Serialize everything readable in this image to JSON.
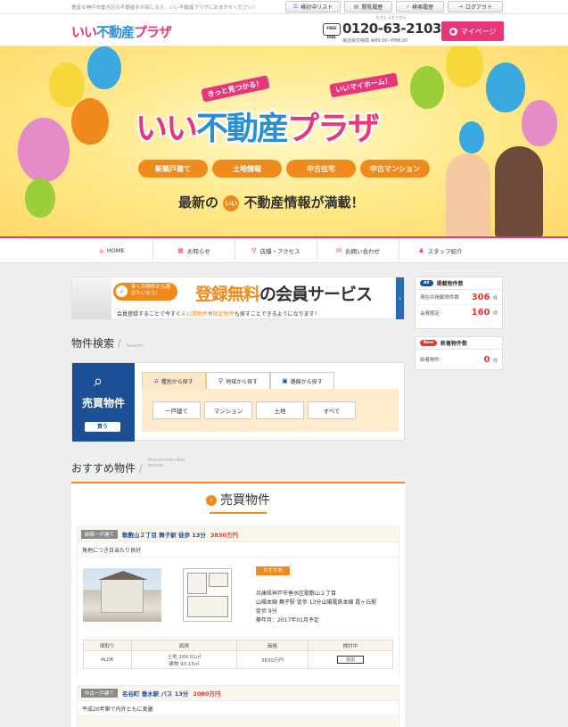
{
  "topbar": {
    "tagline": "豊富な神戸市垂水区の不動産をお探しなら、いい不動産プラザにおまかせください！",
    "buttons": [
      {
        "icon": "list-icon",
        "label": "検討中リスト"
      },
      {
        "icon": "history-icon",
        "label": "閲覧履歴"
      },
      {
        "icon": "search-icon",
        "label": "検索履歴"
      },
      {
        "icon": "logout-icon",
        "label": "ログアウト"
      }
    ]
  },
  "header": {
    "logo": "いい不動産プラザ",
    "phone_badge": "FREE DIAL",
    "phone": "0120-63-2103",
    "phone_ruby": "むさし  ふどうさん",
    "hours": "電話受付時間 AM9:00~PM8:00",
    "mypage": "マイページ"
  },
  "hero": {
    "kicker_left": "きっと見つかる！",
    "kicker_right": "いいマイホーム！",
    "title_a": "いい",
    "title_b": "不動産",
    "title_c": "プラザ",
    "tags": [
      "新築戸建て",
      "土地情報",
      "中古住宅",
      "中古マンション"
    ],
    "banner_pre": "最新の",
    "banner_icon": "いい",
    "banner_post": "不動産情報が満載！"
  },
  "nav": [
    {
      "icon": "home-icon",
      "label": "HOME"
    },
    {
      "icon": "news-icon",
      "label": "お知らせ"
    },
    {
      "icon": "pin-icon",
      "label": "店舗・アクセス"
    },
    {
      "icon": "mail-icon",
      "label": "お問い合わせ"
    },
    {
      "icon": "person-icon",
      "label": "スタッフ紹介"
    }
  ],
  "register": {
    "bubble": "多くの物件から選びたいなら！",
    "big_a": "登録無料",
    "big_b": "の会員サービス",
    "sub_a": "会員登録することで今すぐ",
    "sub_b": "未公開物件",
    "sub_c": "や",
    "sub_d": "限定物件",
    "sub_e": "も探すことできるようになります！"
  },
  "sidebar": {
    "listed_pill": "All",
    "listed_title": "掲載物件数",
    "rows": [
      {
        "label": "現在の掲載物件数",
        "value": "306",
        "unit": "件"
      },
      {
        "label": "会員限定",
        "value": "160",
        "unit": "件"
      }
    ],
    "new_pill": "New",
    "new_title": "新着物件数",
    "new_row": {
      "label": "新着物件",
      "value": "0",
      "unit": "件"
    }
  },
  "search": {
    "heading": "物件検索",
    "heading_en": "Search",
    "buy_title": "売買物件",
    "buy_badge": "買う",
    "tabs": [
      "種別から探す",
      "地域から探す",
      "路線から探す"
    ],
    "types": [
      "一戸建て",
      "マンション",
      "土地",
      "すべて"
    ]
  },
  "recommended": {
    "heading": "おすすめ物件",
    "heading_en": "Recommended estate",
    "section_title": "売買物件",
    "cards": [
      {
        "type": "新築一戸建て",
        "location": "歌敷山２丁目  舞子駅 徒歩 13分",
        "price": "3830万円",
        "desc": "角地につき日当たり良好",
        "badge": "おすすめ",
        "addr": "兵庫県神戸市垂水区歌敷山２丁目",
        "access": "山陽本線 舞子駅 徒歩 13分山陽電鉄本線 霞ヶ丘駅",
        "walk": "徒歩 9分",
        "built": "築年月：2017年01月予定",
        "cols": [
          "間取り",
          "面積",
          "価格",
          "検討中"
        ],
        "madori": "4LDK",
        "area1": "土地 109.01㎡",
        "area2": "建物 93.15㎡",
        "price_cell": "3830万円",
        "add": "追加"
      },
      {
        "type": "中古一戸建て",
        "location": "名谷町  垂水駅 バス 13分",
        "price": "2080万円",
        "desc": "平成20年築で内外ともに美麗"
      }
    ]
  }
}
